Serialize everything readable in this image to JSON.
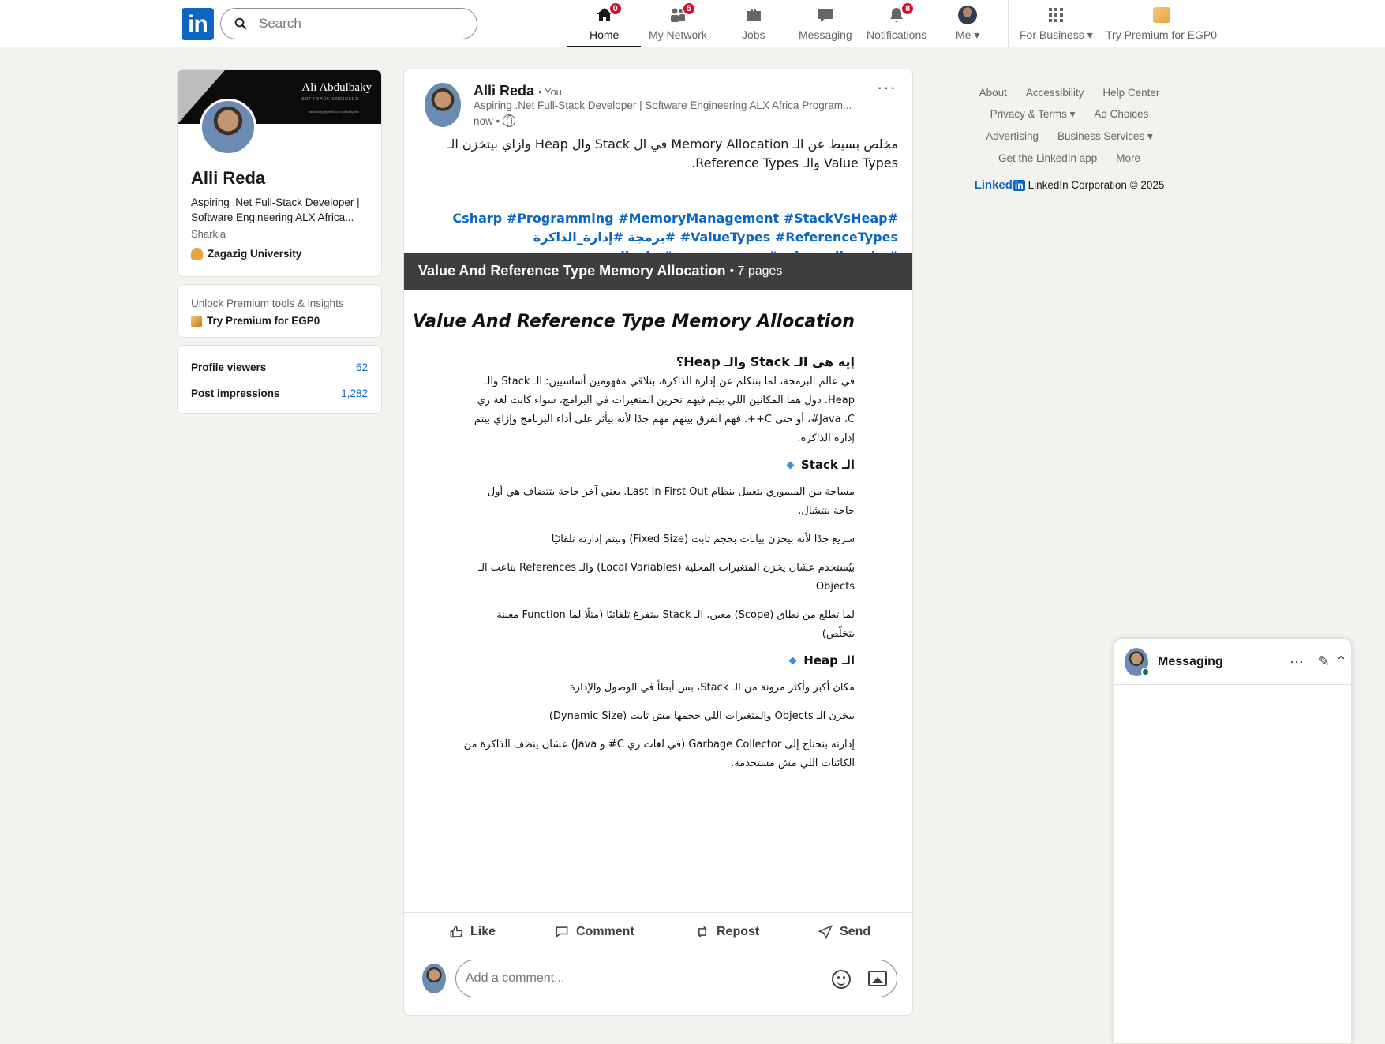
{
  "nav": {
    "logo": "in",
    "search_placeholder": "Search",
    "items": [
      {
        "label": "Home",
        "badge": "0"
      },
      {
        "label": "My Network",
        "badge": "5"
      },
      {
        "label": "Jobs",
        "badge": ""
      },
      {
        "label": "Messaging",
        "badge": ""
      },
      {
        "label": "Notifications",
        "badge": "8"
      },
      {
        "label": "Me",
        "badge": ""
      },
      {
        "label": "For Business",
        "badge": ""
      },
      {
        "label": "Try Premium for EGP0",
        "badge": ""
      }
    ]
  },
  "profile": {
    "banner_name": "Ali Abdulbaky",
    "banner_sub": "SOFTWARE ENGINEER",
    "banner_line": "abdulbaky@gmail.com  |  alibaky.dev",
    "name": "Alli Reda",
    "headline": "Aspiring .Net Full-Stack Developer | Software Engineering ALX Africa...",
    "location": "Sharkia",
    "university": "Zagazig University"
  },
  "premium": {
    "text": "Unlock Premium tools & insights",
    "link": "Try Premium for EGP0"
  },
  "stats": {
    "viewers_label": "Profile viewers",
    "viewers_value": "62",
    "impressions_label": "Post impressions",
    "impressions_value": "1,282"
  },
  "post": {
    "author": "Alli Reda",
    "you": "• You",
    "headline": "Aspiring .Net Full-Stack Developer | Software Engineering ALX Africa Program...",
    "time": "now •",
    "more": "···",
    "text": "مخلص بسيط عن الـ Memory Allocation في ال Stack وال Heap وازاي بيتخزن الـ Value Types والـ Reference Types.",
    "hashtags": "#Csharp #Programming #MemoryManagement #StackVsHeap #ValueTypes #ReferenceTypes #برمجة #إدارة_الذاكرة #تطوير_البرمجيات #مبرمجين_عرب #تعلم_البرمجة",
    "doc_title": "Value And Reference Type Memory Allocation",
    "doc_pages": "• 7 pages"
  },
  "document": {
    "title": "Value And Reference Type Memory Allocation",
    "heading": "إيه هي الـ Stack والـ Heap؟",
    "intro": "في عالم البرمجة، لما بنتكلم عن إدارة الذاكرة، بنلاقي مفهومين أساسيين: الـ Stack والـ Heap. دول هما المكانين اللي بيتم فيهم تخزين المتغيرات في البرامج، سواء كانت لغة زي Java ،C#، أو حتى C++. فهم الفرق بينهم مهم جدًا لأنه بيأثر على أداء البرنامج وإزاي بيتم إدارة الذاكرة.",
    "stack_title": "الـ Stack",
    "stack_p1": "مساحة من الميموري بتعمل بنظام Last In First Out. يعني آخر حاجة بتتضاف هي أول حاجة بتتشال.",
    "stack_p2": "سريع جدًا لأنه بيخزن بيانات بحجم ثابت (Fixed Size) وبيتم إدارته تلقائيًا",
    "stack_p3": "بيُستخدم عشان يخزن المتغيرات المحلية (Local Variables) والـ References بتاعت الـ Objects",
    "stack_p4": "لما تطلع من نطاق (Scope) معين، الـ Stack بيتفرغ تلقائيًا (مثلًا لما Function معينة بتخلّص)",
    "heap_title": "الـ Heap",
    "heap_p1": "مكان أكبر وأكثر مرونة من الـ Stack، بس أبطأ في الوصول والإدارة",
    "heap_p2": "بيخزن الـ Objects والمتغيرات اللي حجمها مش ثابت (Dynamic Size)",
    "heap_p3": "إدارته بتحتاج إلى Garbage Collector (في لغات زي C# و Java) عشان ينظف الذاكرة من الكائنات اللي مش مستخدمة."
  },
  "actions": {
    "like": "Like",
    "comment": "Comment",
    "repost": "Repost",
    "send": "Send",
    "comment_placeholder": "Add a comment..."
  },
  "footer": {
    "row1": [
      "About",
      "Accessibility",
      "Help Center"
    ],
    "row2": [
      "Privacy & Terms ▾",
      "Ad Choices"
    ],
    "row3": [
      "Advertising",
      "Business Services ▾"
    ],
    "row4": [
      "Get the LinkedIn app",
      "More"
    ],
    "brand": "Linked",
    "brand_box": "in",
    "copyright": "LinkedIn Corporation © 2025"
  },
  "messaging": {
    "title": "Messaging"
  }
}
